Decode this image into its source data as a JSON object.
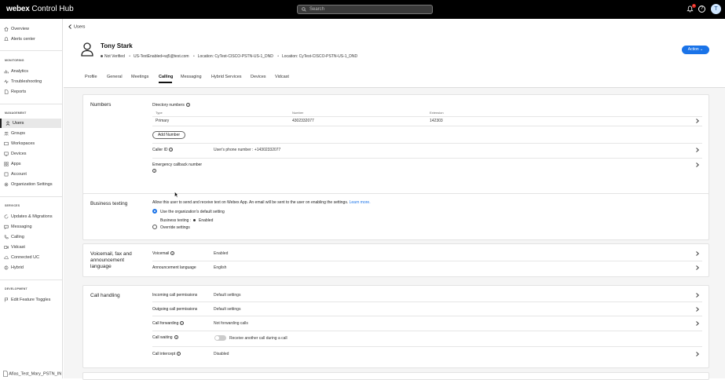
{
  "topbar": {
    "brand_bold": "webex",
    "brand_rest": "Control Hub",
    "search_placeholder": "Search",
    "avatar_initial": "T",
    "notif_count": "1"
  },
  "sidebar": {
    "top_items": [
      {
        "label": "Overview"
      },
      {
        "label": "Alerts center"
      }
    ],
    "monitoring_header": "MONITORING",
    "monitoring_items": [
      {
        "label": "Analytics"
      },
      {
        "label": "Troubleshooting"
      },
      {
        "label": "Reports"
      }
    ],
    "management_header": "MANAGEMENT",
    "management_items": [
      {
        "label": "Users"
      },
      {
        "label": "Groups"
      },
      {
        "label": "Workspaces"
      },
      {
        "label": "Devices"
      },
      {
        "label": "Apps"
      },
      {
        "label": "Account"
      },
      {
        "label": "Organization Settings"
      }
    ],
    "services_header": "SERVICES",
    "services_items": [
      {
        "label": "Updates & Migrations"
      },
      {
        "label": "Messaging"
      },
      {
        "label": "Calling"
      },
      {
        "label": "Vidcast"
      },
      {
        "label": "Connected UC"
      },
      {
        "label": "Hybrid"
      }
    ],
    "development_header": "DEVELOPMENT",
    "development_items": [
      {
        "label": "Edit Feature Toggles"
      }
    ],
    "bottom_file": "Afias_Test_Mary_PSTN_IN"
  },
  "header": {
    "back_label": "Users",
    "user_name": "Tony Stark",
    "status": "Not Verified",
    "email": "US-TextEnabled+wj5@test.com",
    "location1": "Location: CyTest-CISCO-PSTN-US-1_DND",
    "location2": "Location: CyTest-CISCO-PSTN-US-1_DND",
    "action_label": "Action"
  },
  "tabs": [
    {
      "label": "Profile"
    },
    {
      "label": "General"
    },
    {
      "label": "Meetings"
    },
    {
      "label": "Calling"
    },
    {
      "label": "Messaging"
    },
    {
      "label": "Hybrid Services"
    },
    {
      "label": "Devices"
    },
    {
      "label": "Vidcast"
    }
  ],
  "numbers": {
    "title": "Numbers",
    "directory_label": "Directory numbers",
    "col_type": "Type",
    "col_number": "Number",
    "col_extension": "Extension",
    "row": {
      "type": "Primary",
      "number": "4302332077",
      "extension": "142303"
    },
    "add_number": "Add Number",
    "caller_id_label": "Caller ID",
    "caller_id_value": "User's phone number : +14302332077",
    "emergency_label": "Emergency callback number"
  },
  "business_texting": {
    "title": "Business texting",
    "description": "Allow this user to send and receive text on Webex App. An email will be sent to the user on enabling the settings.",
    "learn_more": "Learn more.",
    "option_default": "Use the organization's default setting",
    "status_label": "Business texting :",
    "status_value": "Enabled",
    "option_override": "Override settings"
  },
  "voicemail": {
    "title": "Voicemail, fax and announcement language",
    "voicemail_label": "Voicemail",
    "voicemail_value": "Enabled",
    "announcement_label": "Announcement language",
    "announcement_value": "English"
  },
  "call_handling": {
    "title": "Call handling",
    "incoming_label": "Incoming call permissions",
    "incoming_value": "Default settings",
    "outgoing_label": "Outgoing call permissions",
    "outgoing_value": "Default settings",
    "forwarding_label": "Call forwarding",
    "forwarding_value": "Not forwarding calls",
    "waiting_label": "Call waiting",
    "waiting_value": "Receive another call during a call",
    "intercept_label": "Call intercept",
    "intercept_value": "Disabled"
  },
  "colors": {
    "accent": "#1a73e8",
    "topbar": "#000000"
  }
}
